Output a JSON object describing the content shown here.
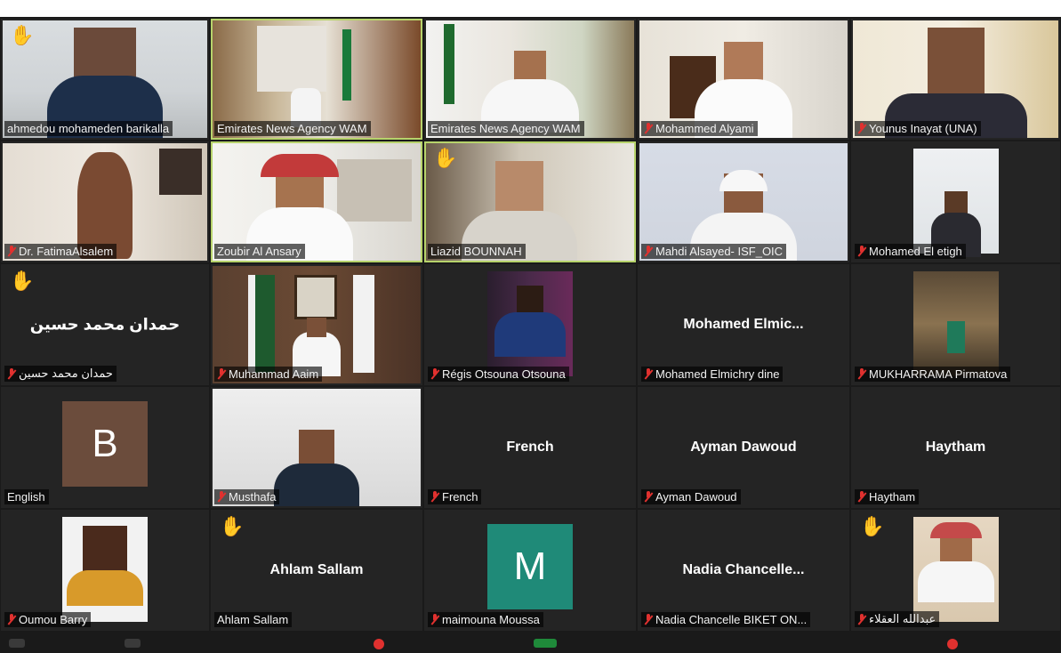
{
  "colors": {
    "background": "#1a1a1a",
    "tile": "#242424",
    "active_speaker_border": "#b7d36b",
    "muted_mic": "#e0312f",
    "raised_hand": "#f3b43c",
    "avatar_b": "#6b4c3c",
    "avatar_m": "#1f8a78"
  },
  "participants": [
    {
      "name": "ahmedou mohameden barikalla",
      "muted": false,
      "hand": true,
      "video": true
    },
    {
      "name": "Emirates News Agency WAM",
      "muted": false,
      "hand": false,
      "video": true,
      "active": true
    },
    {
      "name": "Emirates News Agency WAM",
      "muted": false,
      "hand": false,
      "video": true
    },
    {
      "name": "Mohammed Alyami",
      "muted": true,
      "hand": false,
      "video": true
    },
    {
      "name": "Younus Inayat (UNA)",
      "muted": true,
      "hand": false,
      "video": true
    },
    {
      "name": "Dr. FatimaAlsalem",
      "muted": true,
      "hand": false,
      "video": true
    },
    {
      "name": "Zoubir Al Ansary",
      "muted": false,
      "hand": false,
      "video": true,
      "active": true
    },
    {
      "name": "Liazid BOUNNAH",
      "muted": false,
      "hand": true,
      "video": true,
      "active": true
    },
    {
      "name": "Mahdi Alsayed- ISF_OIC",
      "muted": true,
      "hand": false,
      "video": true
    },
    {
      "name": "Mohamed El etigh",
      "muted": true,
      "hand": false,
      "video": true
    },
    {
      "name": "حمدان محمد حسين",
      "display": "حمدان محمد حسين",
      "muted": true,
      "hand": true,
      "video": false
    },
    {
      "name": "Muhammad Aaim",
      "muted": true,
      "hand": false,
      "video": true
    },
    {
      "name": "Régis Otsouna Otsouna",
      "muted": true,
      "hand": false,
      "video": true
    },
    {
      "name": "Mohamed Elmichry dine",
      "display": "Mohamed  Elmic...",
      "muted": true,
      "hand": false,
      "video": false
    },
    {
      "name": "MUKHARRAMA Pirmatova",
      "muted": true,
      "hand": false,
      "video": true
    },
    {
      "name": "English",
      "avatar_letter": "B",
      "muted": false,
      "hand": false,
      "video": false
    },
    {
      "name": "Musthafa",
      "muted": true,
      "hand": false,
      "video": true
    },
    {
      "name": "French",
      "display": "French",
      "muted": true,
      "hand": false,
      "video": false
    },
    {
      "name": "Ayman Dawoud",
      "display": "Ayman Dawoud",
      "muted": true,
      "hand": false,
      "video": false
    },
    {
      "name": "Haytham",
      "display": "Haytham",
      "muted": true,
      "hand": false,
      "video": false
    },
    {
      "name": "Oumou Barry",
      "muted": true,
      "hand": false,
      "video": true
    },
    {
      "name": "Ahlam Sallam",
      "display": "Ahlam Sallam",
      "muted": false,
      "hand": true,
      "video": false
    },
    {
      "name": "maimouna Moussa",
      "avatar_letter": "M",
      "muted": true,
      "hand": false,
      "video": false
    },
    {
      "name": "Nadia Chancelle BIKET ON...",
      "display": "Nadia  Chancelle...",
      "muted": true,
      "hand": false,
      "video": false
    },
    {
      "name": "عبدالله العقلاء",
      "muted": true,
      "hand": true,
      "video": true
    }
  ]
}
